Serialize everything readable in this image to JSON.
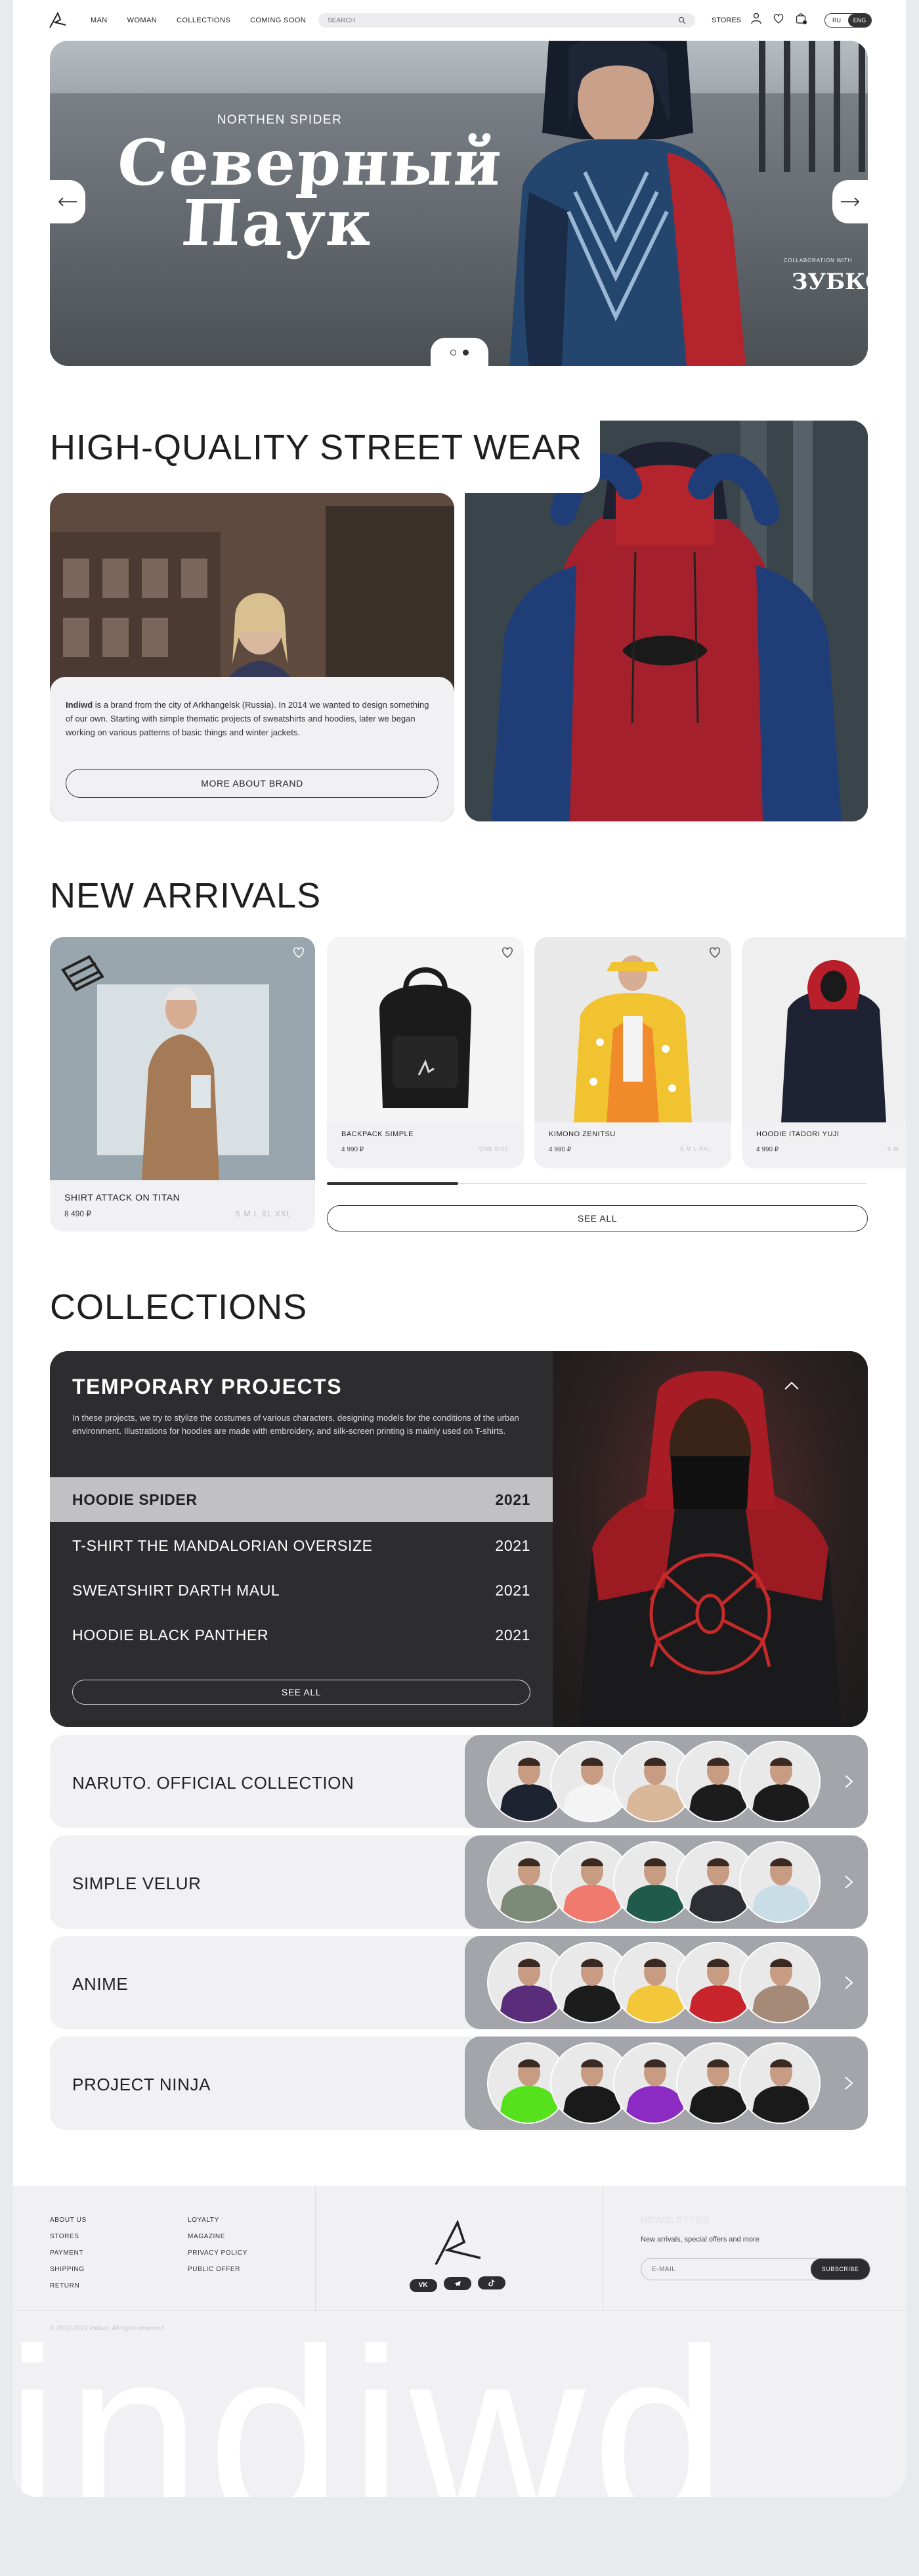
{
  "header": {
    "nav": [
      "MAN",
      "WOMAN",
      "COLLECTIONS",
      "COMING SOON"
    ],
    "search_placeholder": "SEARCH",
    "stores": "STORES",
    "lang": [
      "RU",
      "ENG"
    ],
    "lang_active": "ENG",
    "icons": [
      "logo-icon",
      "search-icon",
      "user-icon",
      "heart-icon",
      "bag-icon"
    ]
  },
  "hero": {
    "subtitle": "NORTHEN SPIDER",
    "title_line1": "Северный",
    "title_line2": "Паук",
    "collab_label": "COLLABORATION WITH",
    "collab_brand": "ЗУБКОВ",
    "slides": 2,
    "active_slide": 2
  },
  "about": {
    "title": "HIGH-QUALITY STREET WEAR",
    "brand": "Indiwd",
    "text": " is a brand from the city of Arkhangelsk (Russia). In 2014 we wanted to design something of our own. Starting with simple thematic projects of sweatshirts and hoodies, later we began working on various patterns of basic things and winter jackets.",
    "button": "MORE ABOUT BRAND"
  },
  "arrivals": {
    "title": "NEW ARRIVALS",
    "see_all": "SEE ALL",
    "products": [
      {
        "name": "SHIRT ATTACK ON TITAN",
        "price": "8 490 ₽",
        "sizes": "S  M  L  XL  XXL"
      },
      {
        "name": "BACKPACK SIMPLE",
        "price": "4 990 ₽",
        "sizes": "ONE SIZE"
      },
      {
        "name": "KIMONO ZENITSU",
        "price": "4 990 ₽",
        "sizes": "S  M  L  XXL"
      },
      {
        "name": "HOODIE ITADORI YUJI",
        "price": "4 990 ₽",
        "sizes": "S  M"
      }
    ]
  },
  "collections": {
    "title": "COLLECTIONS",
    "temporary": {
      "title": "TEMPORARY PROJECTS",
      "desc": "In these projects, we try to stylize the costumes of various characters, designing models for the conditions of the urban environment. Illustrations for hoodies are made with embroidery, and silk-screen printing is mainly used on T-shirts.",
      "items": [
        {
          "name": "HOODIE SPIDER",
          "year": "2021"
        },
        {
          "name": "T-SHIRT THE MANDALORIAN OVERSIZE",
          "year": "2021"
        },
        {
          "name": "SWEATSHIRT DARTH MAUL",
          "year": "2021"
        },
        {
          "name": "HOODIE BLACK PANTHER",
          "year": "2021"
        }
      ],
      "see_all": "SEE ALL"
    },
    "rows": [
      {
        "name": "NARUTO. OFFICIAL COLLECTION",
        "colors": [
          "#1d2330",
          "#f4f4f4",
          "#d9b89a",
          "#1c1c1c",
          "#1b1b1b"
        ]
      },
      {
        "name": "SIMPLE VELUR",
        "colors": [
          "#7d8a78",
          "#f07a6e",
          "#1f5a4a",
          "#2e2f35",
          "#c8dde6"
        ]
      },
      {
        "name": "ANIME",
        "colors": [
          "#5a2d7a",
          "#1c1c1c",
          "#f2c73a",
          "#c8242c",
          "#a48a77"
        ]
      },
      {
        "name": "PROJECT NINJA",
        "colors": [
          "#55e21c",
          "#1a1a1a",
          "#8c2bc4",
          "#1a1a1a",
          "#1a1a1a"
        ]
      }
    ]
  },
  "footer": {
    "col1": [
      "ABOUT US",
      "STORES",
      "PAYMENT",
      "SHIPPING",
      "RETURN"
    ],
    "col2": [
      "LOYALTY",
      "MAGAZINE",
      "PRIVACY POLICY",
      "PUBLIC OFFER"
    ],
    "socials": [
      "VK",
      "TG",
      "TT"
    ],
    "newsletter_title": "NEWSLETTER",
    "newsletter_sub": "New arrivals, special offers and more",
    "email_placeholder": "E-MAIL",
    "subscribe": "SUBSCRIBE",
    "copyright": "© 2012-2022 indiwd. All rights reserved",
    "bigword": "indiwd"
  },
  "colors": {
    "dark": "#2d2d2f",
    "card": "#f1f1f3",
    "thumbs": "#a4a5ab",
    "hoodie_red": "#b3242c",
    "jacket_blue": "#24466e"
  }
}
